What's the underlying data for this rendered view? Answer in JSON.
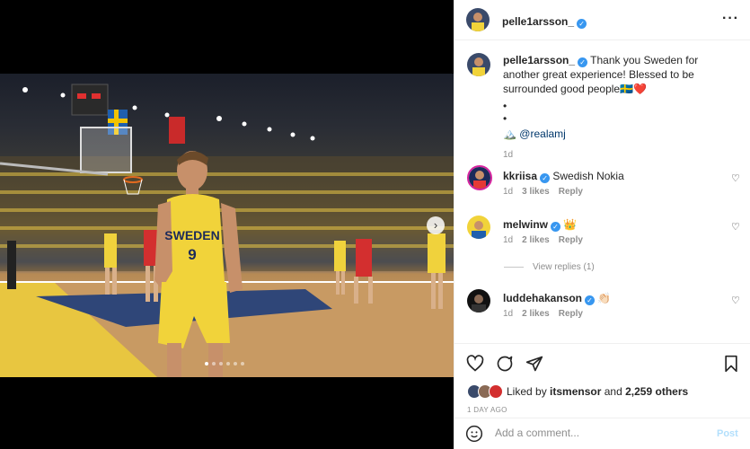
{
  "post": {
    "username": "pelle1arsson_",
    "caption": "Thank you Sweden for another great experience! Blessed to be surrounded good people🇸🇪❤️",
    "caption_dots": [
      "•",
      "•"
    ],
    "tag_mention": "@realamj",
    "caption_time": "1d",
    "jersey_text": "SWEDEN",
    "jersey_number": "9"
  },
  "comments": [
    {
      "username": "kkriisa",
      "text": "Swedish Nokia",
      "time": "1d",
      "likes": "3 likes",
      "reply": "Reply"
    },
    {
      "username": "melwinw",
      "text": "👑",
      "time": "1d",
      "likes": "2 likes",
      "reply": "Reply"
    },
    {
      "username": "luddehakanson",
      "text": "👏🏻",
      "time": "1d",
      "likes": "2 likes",
      "reply": "Reply"
    }
  ],
  "view_replies": "View replies (1)",
  "likes": {
    "prefix": "Liked by",
    "user": "itsmensor",
    "joiner": "and",
    "others": "2,259 others"
  },
  "time_ago": "1 DAY AGO",
  "comment_box": {
    "placeholder": "Add a comment...",
    "post_label": "Post"
  },
  "icons": {
    "more": "more-horizontal-icon",
    "heart": "heart-icon",
    "comment": "comment-icon",
    "share": "share-icon",
    "save": "bookmark-icon",
    "emoji": "emoji-icon",
    "next": "chevron-right-icon"
  },
  "colors": {
    "verified": "#3897f0",
    "link": "#00376b",
    "post_disabled": "#b2dffc",
    "muted": "#8e8e8e"
  },
  "carousel": {
    "slides": 6,
    "active": 0
  }
}
